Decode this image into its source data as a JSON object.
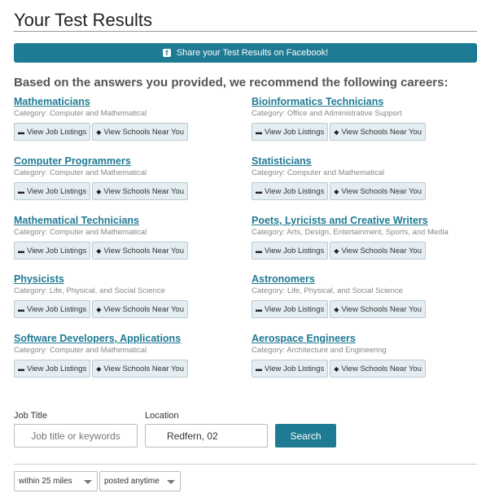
{
  "page": {
    "title": "Your Test Results"
  },
  "facebook": {
    "label": "Share your Test Results on Facebook!",
    "icon": "facebook-icon"
  },
  "intro": "Based on the answers you provided, we recommend the following careers:",
  "buttons": {
    "jobs": "View Job Listings",
    "schools": "View Schools Near You"
  },
  "careers": [
    {
      "name": "Mathematicians",
      "category": "Category: Computer and Mathematical"
    },
    {
      "name": "Bioinformatics Technicians",
      "category": "Category: Office and Administrative Support"
    },
    {
      "name": "Computer Programmers",
      "category": "Category: Computer and Mathematical"
    },
    {
      "name": "Statisticians",
      "category": "Category: Computer and Mathematical"
    },
    {
      "name": "Mathematical Technicians",
      "category": "Category: Computer and Mathematical"
    },
    {
      "name": "Poets, Lyricists and Creative Writers",
      "category": "Category: Arts, Design, Entertainment, Sports, and Media"
    },
    {
      "name": "Physicists",
      "category": "Category: Life, Physical, and Social Science"
    },
    {
      "name": "Astronomers",
      "category": "Category: Life, Physical, and Social Science"
    },
    {
      "name": "Software Developers, Applications",
      "category": "Category: Computer and Mathematical"
    },
    {
      "name": "Aerospace Engineers",
      "category": "Category: Architecture and Engineering"
    }
  ],
  "search": {
    "job_title_label": "Job Title",
    "job_title_placeholder": "Job title or keywords",
    "job_title_value": "",
    "location_label": "Location",
    "location_value": "Redfern, 02",
    "button": "Search"
  },
  "filters": {
    "distance": "within 25 miles",
    "posted": "posted anytime"
  },
  "colors": {
    "accent": "#1f7a93",
    "button_bg": "#e4edf2"
  }
}
